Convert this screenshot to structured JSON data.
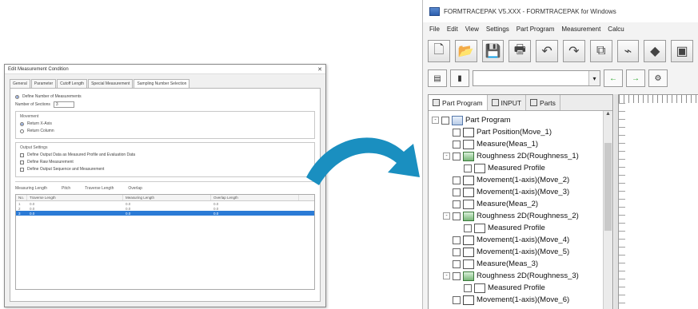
{
  "dialog": {
    "title": "Edit Measurement Condition",
    "tabs": [
      "General",
      "Parameter",
      "Cutoff Length",
      "Special Measurement",
      "Sampling Number Selection"
    ],
    "options": {
      "radio_label": "Define Number of Measurements",
      "number_label": "Number of Sections",
      "number_value": "3"
    },
    "group_move": {
      "title": "Movement",
      "radio1": "Return X-Axis",
      "radio2": "Return Column"
    },
    "group_output": {
      "title": "Output Settings",
      "chk1": "Define Output Data as Measured Profile and Evaluation Data",
      "chk2": "Define Raw Measurement",
      "chk3": "Define Output Sequence and Measurement"
    },
    "fields": [
      "Measuring Length",
      "Pitch",
      "Traverse Length",
      "Overlap"
    ],
    "table": {
      "headers": [
        "No.",
        "Traverse Length",
        "Measuring Length",
        "Overlap Length"
      ],
      "rows": [
        [
          "1",
          "0.0",
          "0.0",
          "0.0"
        ],
        [
          "2",
          "0.0",
          "0.0",
          "0.0"
        ],
        [
          "3",
          "0.0",
          "0.0",
          "0.0"
        ]
      ]
    }
  },
  "app": {
    "title": "FORMTRACEPAK V5.XXX - FORMTRACEPAK for Windows",
    "menu": [
      "File",
      "Edit",
      "View",
      "Settings",
      "Part Program",
      "Measurement",
      "Calcu"
    ],
    "panel_tabs": [
      "Part Program",
      "INPUT",
      "Parts"
    ],
    "tree": [
      {
        "label": "Part Program",
        "icon": "program",
        "indent": 0,
        "expander": "-"
      },
      {
        "label": "Part Position(Move_1)",
        "icon": "move",
        "indent": 1
      },
      {
        "label": "Measure(Meas_1)",
        "icon": "meas",
        "indent": 1
      },
      {
        "label": "Roughness 2D(Roughness_1)",
        "icon": "rough",
        "indent": 1,
        "expander": "-"
      },
      {
        "label": "Measured Profile",
        "icon": "prof",
        "indent": 2
      },
      {
        "label": "Movement(1-axis)(Move_2)",
        "icon": "move",
        "indent": 1
      },
      {
        "label": "Movement(1-axis)(Move_3)",
        "icon": "move",
        "indent": 1
      },
      {
        "label": "Measure(Meas_2)",
        "icon": "meas",
        "indent": 1
      },
      {
        "label": "Roughness 2D(Roughness_2)",
        "icon": "rough",
        "indent": 1,
        "expander": "-"
      },
      {
        "label": "Measured Profile",
        "icon": "prof",
        "indent": 2
      },
      {
        "label": "Movement(1-axis)(Move_4)",
        "icon": "move",
        "indent": 1
      },
      {
        "label": "Movement(1-axis)(Move_5)",
        "icon": "move",
        "indent": 1
      },
      {
        "label": "Measure(Meas_3)",
        "icon": "meas",
        "indent": 1
      },
      {
        "label": "Roughness 2D(Roughness_3)",
        "icon": "rough",
        "indent": 1,
        "expander": "-"
      },
      {
        "label": "Measured Profile",
        "icon": "prof",
        "indent": 2
      },
      {
        "label": "Movement(1-axis)(Move_6)",
        "icon": "move",
        "indent": 1
      }
    ]
  },
  "colors": {
    "arrow": "#1a8fc0",
    "selection": "#2b7bd6"
  }
}
